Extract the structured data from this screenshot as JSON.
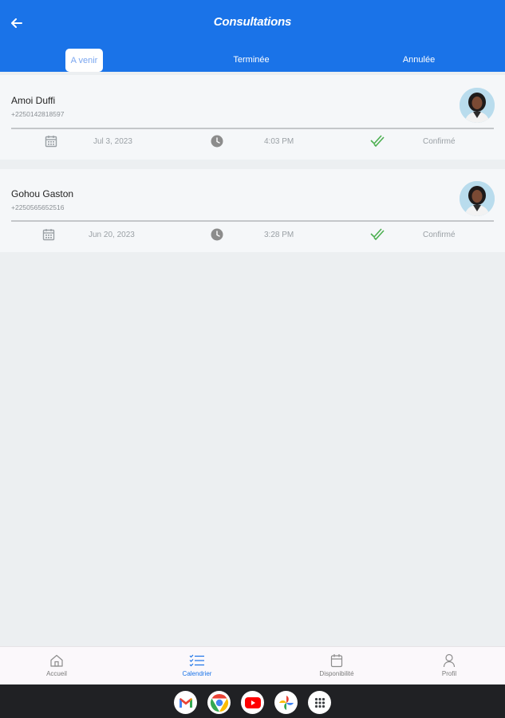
{
  "header": {
    "title": "Consultations",
    "back_icon": "arrow-left-icon",
    "color": "#1a73e8"
  },
  "tabs": [
    {
      "label": "A venir",
      "active": true
    },
    {
      "label": "Terminée",
      "active": false
    },
    {
      "label": "Annulée",
      "active": false
    }
  ],
  "appointments": [
    {
      "name": "Amoi Duffi",
      "phone": "+2250142818597",
      "date": "Jul 3, 2023",
      "time": "4:03 PM",
      "status": "Confirmé"
    },
    {
      "name": "Gohou Gaston",
      "phone": "+2250565652516",
      "date": "Jun 20, 2023",
      "time": "3:28 PM",
      "status": "Confirmé"
    }
  ],
  "bottom_nav": [
    {
      "label": "Accueil",
      "icon": "home-icon",
      "active": false
    },
    {
      "label": "Calendrier",
      "icon": "checklist-icon",
      "active": true
    },
    {
      "label": "Disponibilité",
      "icon": "calendar-icon",
      "active": false
    },
    {
      "label": "Profil",
      "icon": "person-icon",
      "active": false
    }
  ],
  "dock_apps": [
    "Gmail",
    "Chrome",
    "YouTube",
    "Photos",
    "App drawer"
  ],
  "colors": {
    "status_check": "#4caf50",
    "active_nav": "#1a73e8"
  }
}
